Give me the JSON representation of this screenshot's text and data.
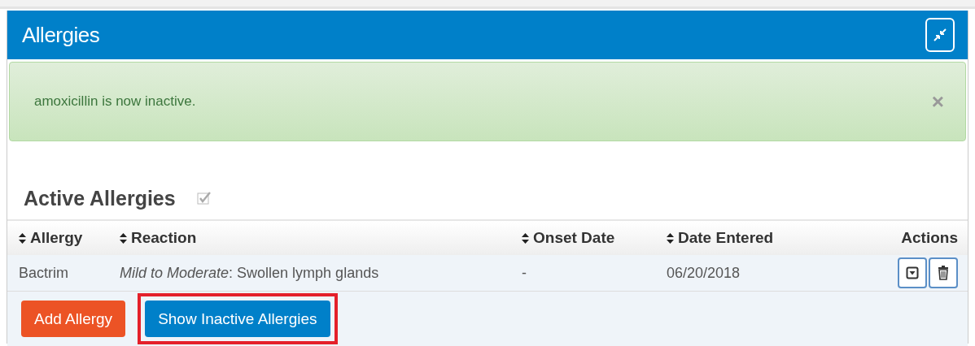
{
  "panel": {
    "title": "Allergies"
  },
  "alert": {
    "message": "amoxicillin is now inactive.",
    "close": "×"
  },
  "section": {
    "title": "Active Allergies",
    "checked": true
  },
  "table": {
    "columns": [
      {
        "label": "Allergy",
        "sortable": true
      },
      {
        "label": "Reaction",
        "sortable": true
      },
      {
        "label": "Onset Date",
        "sortable": true
      },
      {
        "label": "Date Entered",
        "sortable": true
      },
      {
        "label": "Actions",
        "sortable": false
      }
    ],
    "rows": [
      {
        "cells": [
          "Bactrim",
          "*Mild to Moderate*: Swollen lymph glands",
          "-",
          "06/20/2018"
        ]
      }
    ]
  },
  "buttons": [
    {
      "label": "Add Allergy",
      "kind": "danger",
      "highlighted": false
    },
    {
      "label": "Show Inactive Allergies",
      "kind": "primary",
      "highlighted": true
    }
  ]
}
